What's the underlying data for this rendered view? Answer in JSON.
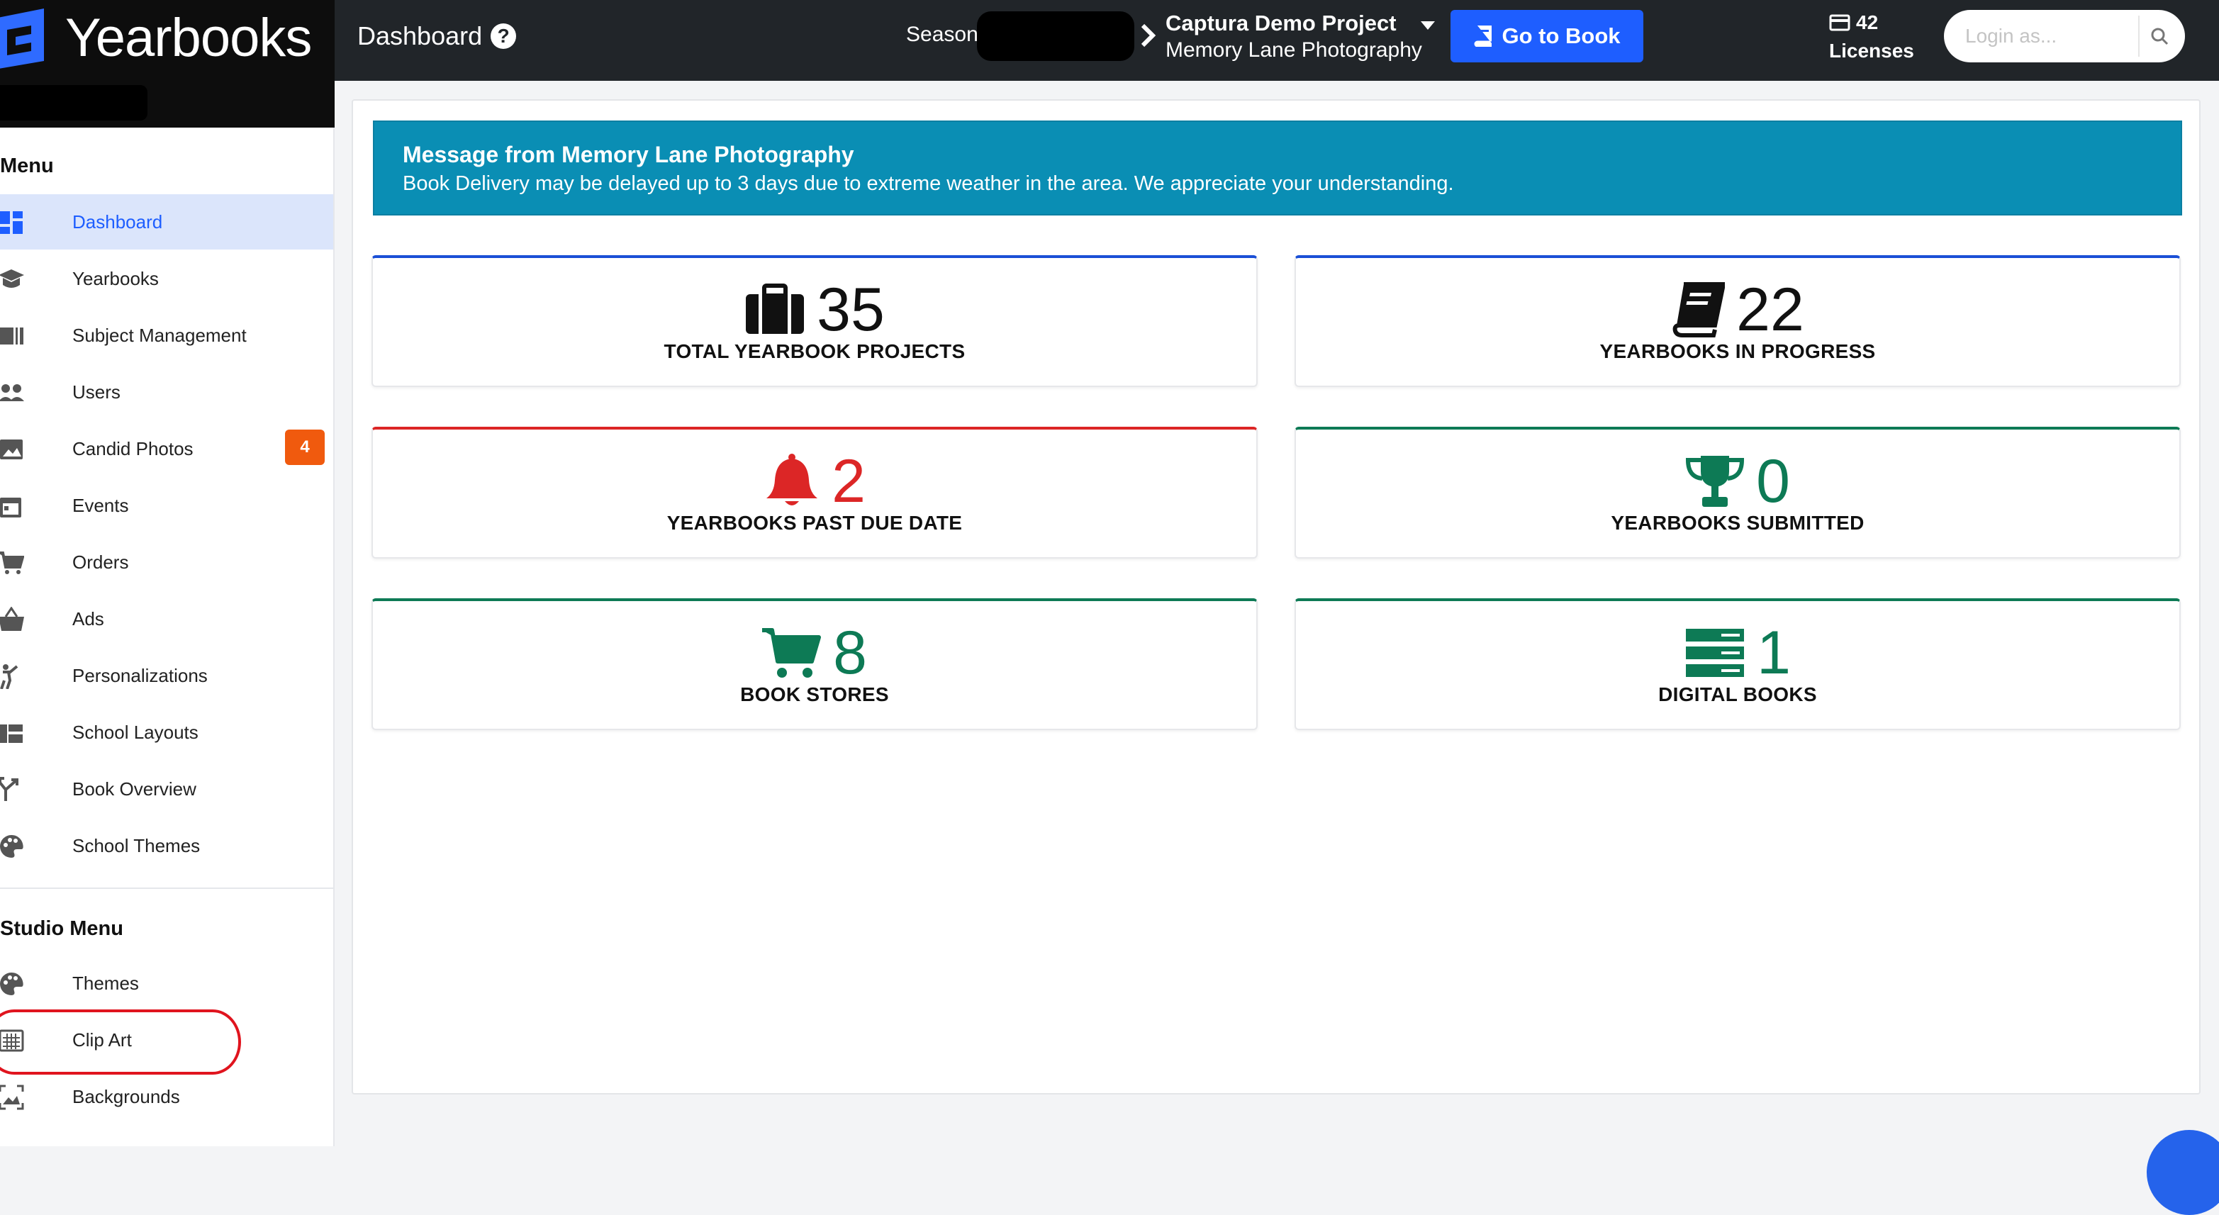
{
  "brand": {
    "name": "Yearbooks"
  },
  "header": {
    "page_title": "Dashboard",
    "season_label": "Season",
    "project_name": "Captura Demo Project",
    "studio_name": "Memory Lane Photography",
    "go_to_book_label": "Go to Book",
    "licenses_count": "42",
    "licenses_label": "Licenses",
    "login_placeholder": "Login as..."
  },
  "sidebar": {
    "menu_heading": "Menu",
    "items": [
      {
        "label": "Dashboard",
        "icon": "dashboard-icon",
        "active": true
      },
      {
        "label": "Yearbooks",
        "icon": "graduation-cap-icon"
      },
      {
        "label": "Subject Management",
        "icon": "id-card-icon"
      },
      {
        "label": "Users",
        "icon": "users-icon"
      },
      {
        "label": "Candid Photos",
        "icon": "image-icon",
        "badge": "4"
      },
      {
        "label": "Events",
        "icon": "calendar-icon"
      },
      {
        "label": "Orders",
        "icon": "cart-icon"
      },
      {
        "label": "Ads",
        "icon": "basket-icon"
      },
      {
        "label": "Personalizations",
        "icon": "person-icon"
      },
      {
        "label": "School Layouts",
        "icon": "layout-icon"
      },
      {
        "label": "Book Overview",
        "icon": "split-arrow-icon"
      },
      {
        "label": "School Themes",
        "icon": "palette-icon"
      }
    ],
    "studio_heading": "Studio Menu",
    "studio_items": [
      {
        "label": "Themes",
        "icon": "palette-icon"
      },
      {
        "label": "Clip Art",
        "icon": "clip-art-icon"
      },
      {
        "label": "Backgrounds",
        "icon": "backgrounds-icon"
      }
    ]
  },
  "alert": {
    "title": "Message from Memory Lane Photography",
    "message": "Book Delivery may be delayed up to 3 days due to extreme weather in the area. We appreciate your understanding."
  },
  "stats": [
    {
      "value": "35",
      "label": "TOTAL YEARBOOK PROJECTS",
      "icon": "briefcase-icon",
      "color": "blue"
    },
    {
      "value": "22",
      "label": "YEARBOOKS IN PROGRESS",
      "icon": "book-icon",
      "color": "blue"
    },
    {
      "value": "2",
      "label": "YEARBOOKS PAST DUE DATE",
      "icon": "bell-icon",
      "color": "red"
    },
    {
      "value": "0",
      "label": "YEARBOOKS SUBMITTED",
      "icon": "trophy-icon",
      "color": "green"
    },
    {
      "value": "8",
      "label": "BOOK STORES",
      "icon": "cart-icon",
      "color": "green"
    },
    {
      "value": "1",
      "label": "DIGITAL BOOKS",
      "icon": "server-icon",
      "color": "green"
    }
  ],
  "colors": {
    "topbar": "#212529",
    "accent_blue": "#1e5eff",
    "alert_bg": "#0a8eb4",
    "danger": "#dc2626",
    "success": "#0d7a55",
    "badge": "#f05a0e"
  }
}
